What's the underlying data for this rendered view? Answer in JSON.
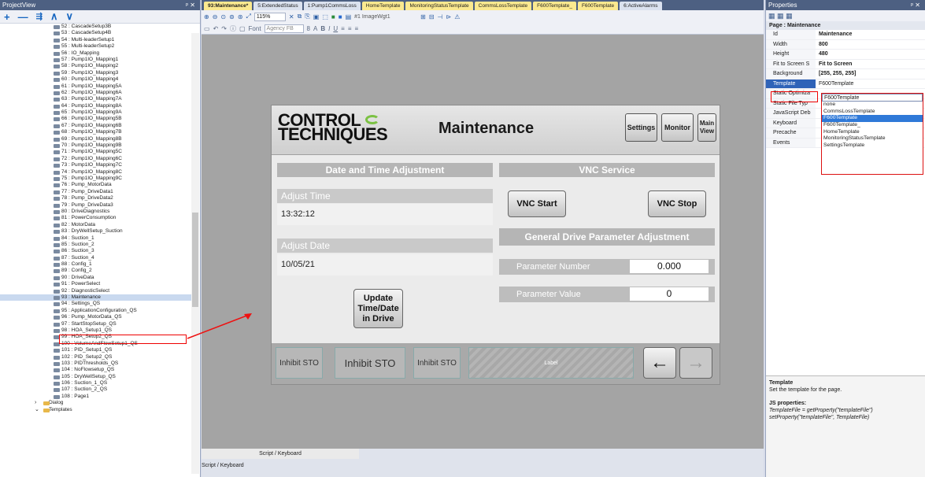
{
  "project_view": {
    "title": "ProjectView",
    "pin": "⨯ ✕",
    "toolbar": [
      "+",
      "—",
      "⭪",
      "∧",
      "∨"
    ],
    "items": [
      "52 : CascadeSetup3B",
      "53 : CascadeSetup4B",
      "54 : Multi-leaderSetup1",
      "55 : Multi-leaderSetup2",
      "56 : IO_Mapping",
      "57 : Pump1IO_Mapping1",
      "58 : Pump1IO_Mapping2",
      "59 : Pump1IO_Mapping3",
      "60 : Pump1IO_Mapping4",
      "61 : Pump1IO_Mapping5A",
      "62 : Pump1IO_Mapping6A",
      "63 : Pump1IO_Mapping7A",
      "64 : Pump1IO_Mapping8A",
      "65 : Pump1IO_Mapping9A",
      "66 : Pump1IO_Mapping5B",
      "67 : Pump1IO_Mapping6B",
      "68 : Pump1IO_Mapping7B",
      "69 : Pump1IO_Mapping8B",
      "70 : Pump1IO_Mapping9B",
      "71 : Pump1IO_Mapping5C",
      "72 : Pump1IO_Mapping6C",
      "73 : Pump1IO_Mapping7C",
      "74 : Pump1IO_Mapping8C",
      "75 : Pump1IO_Mapping9C",
      "76 : Pump_MotorData",
      "77 : Pump_DriveData1",
      "78 : Pump_DriveData2",
      "79 : Pump_DriveData3",
      "80 : DriveDiagnostics",
      "81 : PowerConsumption",
      "82 : MotorData",
      "83 : DryWellSetup_Suction",
      "84 : Suction_1",
      "85 : Suction_2",
      "86 : Suction_3",
      "87 : Suction_4",
      "88 : Config_1",
      "89 : Config_2",
      "90 : DriveData",
      "91 : PowerSelect",
      "92 : DiagnosticSelect",
      "93 : Maintenance",
      "94 : Settings_QS",
      "95 : ApplicationConfiguration_QS",
      "96 : Pump_MotorData_QS",
      "97 : StartStopSetup_QS",
      "98 : HOA_Setup1_QS",
      "99 : HOA_Setup2_QS",
      "100 : VolumeAndFlowSetup1_QS",
      "101 : PID_Setup1_QS",
      "102 : PID_Setup2_QS",
      "103 : PIDThresholds_QS",
      "104 : NoFlowsetup_QS",
      "105 : DryWellSetup_QS",
      "106 : Suction_1_QS",
      "107 : Suction_2_QS",
      "108 : Page1"
    ],
    "selected_index": 41,
    "folders": [
      "Dialog",
      "Templates"
    ]
  },
  "tabs": [
    "93:Maintenance*",
    "5:ExtendedStatus",
    "1:Pump1CommsLoss",
    "HomeTemplate",
    "MonitoringStatusTemplate",
    "CommsLossTemplate",
    "F600Template_",
    "F600Template",
    "6:ActiveAlarms"
  ],
  "toolbar": {
    "zoom": "115%",
    "image_widget": "#1 ImageWgt1",
    "font_label": "Font",
    "font_value": "Agency FB",
    "font_size": "8"
  },
  "page": {
    "logo_line1": "CONTROL",
    "logo_line2": "TECHNIQUES",
    "title": "Maintenance",
    "nav": [
      "Settings",
      "Monitor",
      "Main View"
    ],
    "date_time_header": "Date and Time Adjustment",
    "adjust_time_label": "Adjust Time",
    "time_value": "13:32:12",
    "adjust_date_label": "Adjust Date",
    "date_value": "10/05/21",
    "update_button": "Update Time/Date in Drive",
    "vnc_header": "VNC Service",
    "vnc_start": "VNC Start",
    "vnc_stop": "VNC Stop",
    "gdp_header": "General  Drive Parameter Adjustment",
    "param_number_label": "Parameter Number",
    "param_number_value": "0.000",
    "param_value_label": "Parameter Value",
    "param_value_value": "0",
    "footer": {
      "sto_labels": [
        "Inhibit STO",
        "Inhibit STO",
        "Inhibit STO"
      ],
      "label_text": "Label",
      "label_small": "Label"
    }
  },
  "script_panel": {
    "title": "Script / Keyboard",
    "tabs": "Script / Keyboard"
  },
  "properties": {
    "title": "Properties",
    "group": "Page : Maintenance",
    "rows": [
      {
        "k": "Id",
        "v": "Maintenance"
      },
      {
        "k": "Width",
        "v": "800"
      },
      {
        "k": "Height",
        "v": "480"
      },
      {
        "k": "Fit to Screen S",
        "v": "Fit to Screen"
      },
      {
        "k": "Background",
        "v": "[255, 255, 255]"
      },
      {
        "k": "Template",
        "v": "F600Template"
      },
      {
        "k": "Static Optimiza",
        "v": ""
      },
      {
        "k": "Static File Typ",
        "v": ""
      },
      {
        "k": "JavaScript Deb",
        "v": ""
      },
      {
        "k": "Keyboard",
        "v": ""
      },
      {
        "k": "Precache",
        "v": ""
      },
      {
        "k": "Events",
        "v": ""
      }
    ],
    "dropdown_options": [
      "none",
      "CommsLossTemplate",
      "F600Template",
      "F600Template_",
      "HomeTemplate",
      "MonitoringStatusTemplate",
      "SettingsTemplate"
    ],
    "dropdown_selected": "F600Template",
    "help_title": "Template",
    "help_text": "Set the template for the page.",
    "help_js_title": "JS properties:",
    "help_js1": "TemplateFile = getProperty(\"templateFile\")",
    "help_js2": "setProperty(\"templateFile\", TemplateFile)"
  }
}
